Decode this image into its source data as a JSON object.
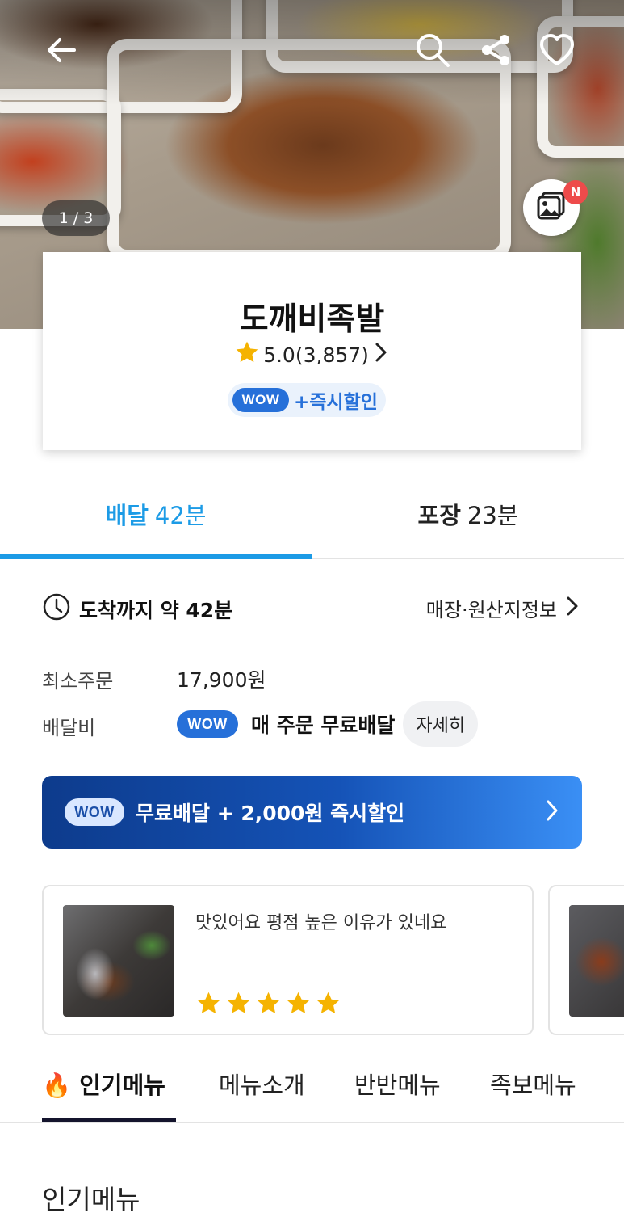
{
  "hero": {
    "photo_counter": "1 / 3",
    "new_badge": "N",
    "icons": [
      "back-arrow-icon",
      "search-icon",
      "share-icon",
      "heart-icon",
      "photo-review-icon"
    ]
  },
  "store": {
    "name": "도깨비족발",
    "rating": "5.0(3,857)",
    "wow_label": "WOW",
    "wow_benefit": "+즉시할인"
  },
  "tabs": [
    {
      "label": "배달",
      "time": "42분",
      "active": true
    },
    {
      "label": "포장",
      "time": "23분",
      "active": false
    }
  ],
  "info": {
    "arrival": "도착까지 약 42분",
    "origin_link": "매장·원산지정보",
    "min_order_label": "최소주문",
    "min_order_value": "17,900원",
    "delivery_fee_label": "배달비",
    "delivery_fee_wow": "WOW",
    "delivery_fee_text": "매 주문 무료배달",
    "detail_button": "자세히"
  },
  "banner": {
    "wow": "WOW",
    "text": "무료배달 + 2,000원 즉시할인"
  },
  "reviews": [
    {
      "text": "맛있어요 평점 높은 이유가 있네요",
      "stars": 5
    }
  ],
  "menu_tabs": [
    {
      "label": "인기메뉴",
      "active": true,
      "icon": "fire-icon"
    },
    {
      "label": "메뉴소개",
      "active": false
    },
    {
      "label": "반반메뉴",
      "active": false
    },
    {
      "label": "족보메뉴",
      "active": false
    }
  ],
  "section_title": "인기메뉴",
  "colors": {
    "accent_blue": "#1c9be6",
    "wow_blue": "#2670d9",
    "star_yellow": "#f5b301",
    "indicator_dark": "#14142d"
  }
}
